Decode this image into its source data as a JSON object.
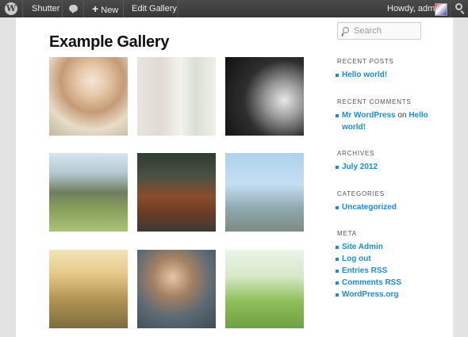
{
  "adminbar": {
    "site_name": "Shutter",
    "new_label": "New",
    "edit_label": "Edit Gallery",
    "greeting": "Howdy, admin"
  },
  "page": {
    "title": "Example Gallery"
  },
  "gallery": {
    "images": [
      {
        "name": "woman-blowing-glitter"
      },
      {
        "name": "room-with-window"
      },
      {
        "name": "wedding-cake-couple"
      },
      {
        "name": "mountain-valley"
      },
      {
        "name": "rusty-car"
      },
      {
        "name": "golden-gate-bridge"
      },
      {
        "name": "grass-sunlight"
      },
      {
        "name": "woman-portrait"
      },
      {
        "name": "cat-in-grass"
      }
    ]
  },
  "sidebar": {
    "search_placeholder": "Search",
    "recent_posts": {
      "title": "RECENT POSTS",
      "items": [
        "Hello world!"
      ]
    },
    "recent_comments": {
      "title": "RECENT COMMENTS",
      "author": "Mr WordPress",
      "on": "on",
      "post_line1": "Hello",
      "post_line2": "world!"
    },
    "archives": {
      "title": "ARCHIVES",
      "items": [
        "July 2012"
      ]
    },
    "categories": {
      "title": "CATEGORIES",
      "items": [
        "Uncategorized"
      ]
    },
    "meta": {
      "title": "META",
      "items": [
        "Site Admin",
        "Log out",
        "Entries RSS",
        "Comments RSS",
        "WordPress.org"
      ]
    }
  },
  "colors": {
    "link": "#1b8be0",
    "adminbar": "#464646"
  }
}
